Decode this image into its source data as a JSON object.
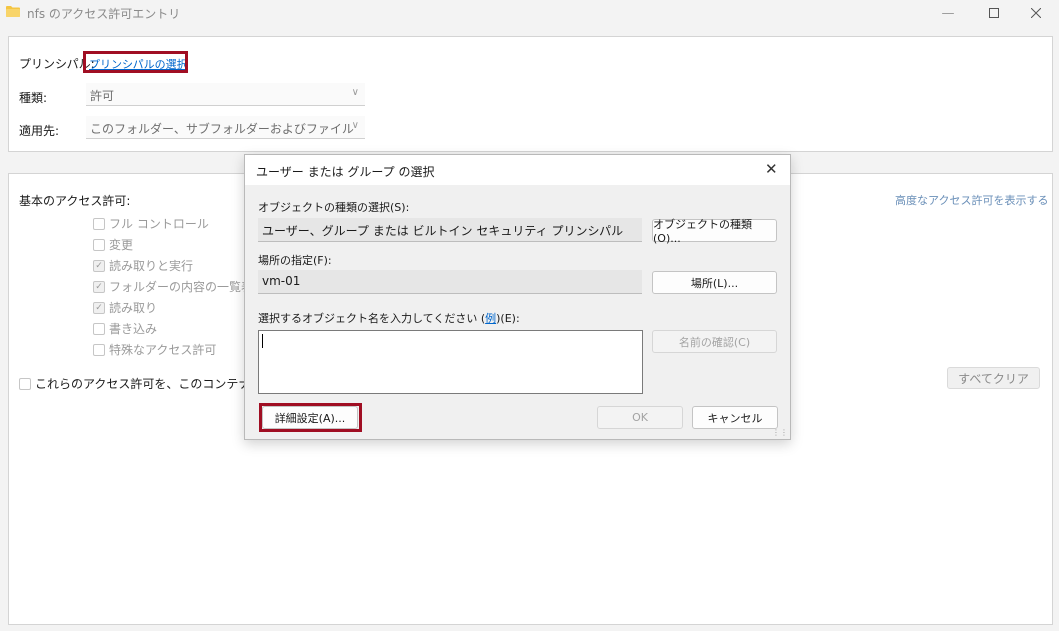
{
  "window": {
    "title": "nfs のアクセス許可エントリ"
  },
  "top_panel": {
    "principal_label": "プリンシパル:",
    "principal_link": "プリンシパルの選択",
    "type_label": "種類:",
    "type_value": "許可",
    "applies_label": "適用先:",
    "applies_value": "このフォルダー、サブフォルダーおよびファイル"
  },
  "permissions": {
    "header": "基本のアクセス許可:",
    "advanced_link": "高度なアクセス許可を表示する",
    "items": [
      {
        "label": "フル コントロール",
        "checked": false
      },
      {
        "label": "変更",
        "checked": false
      },
      {
        "label": "読み取りと実行",
        "checked": true
      },
      {
        "label": "フォルダーの内容の一覧表示",
        "checked": true
      },
      {
        "label": "読み取り",
        "checked": true
      },
      {
        "label": "書き込み",
        "checked": false
      },
      {
        "label": "特殊なアクセス許可",
        "checked": false
      }
    ],
    "apply_container_label": "これらのアクセス許可を、このコンテナーの中",
    "clear_all_label": "すべてクリア"
  },
  "dialog": {
    "title": "ユーザー または グループ の選択",
    "object_type_label": "オブジェクトの種類の選択(S):",
    "object_type_value": "ユーザー、グループ または ビルトイン セキュリティ プリンシパル",
    "object_type_button": "オブジェクトの種類(O)...",
    "location_label": "場所の指定(F):",
    "location_value": "vm-01",
    "location_button": "場所(L)...",
    "names_label_prefix": "選択するオブジェクト名を入力してください (",
    "names_label_link": "例",
    "names_label_suffix": ")(E):",
    "check_names_button": "名前の確認(C)",
    "advanced_button": "詳細設定(A)...",
    "ok_button": "OK",
    "cancel_button": "キャンセル"
  }
}
